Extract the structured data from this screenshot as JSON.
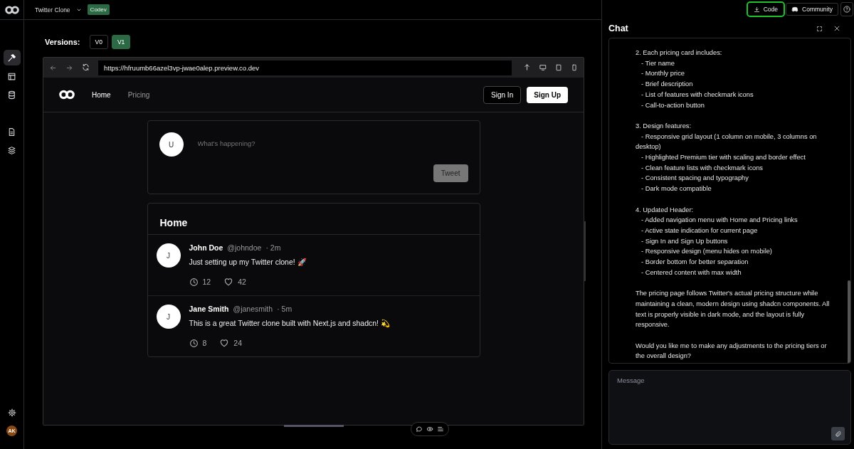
{
  "top_bar": {
    "project": "Twitter Clone",
    "badge": "Codev",
    "buttons": [
      {
        "label": "Code",
        "kind": "download",
        "highlighted": true
      },
      {
        "label": "Community",
        "kind": "discord",
        "highlighted": false
      }
    ]
  },
  "rail": {
    "items": [
      {
        "kind": "hammer",
        "selected": true
      },
      {
        "kind": "layout",
        "selected": false
      },
      {
        "kind": "database",
        "selected": false
      },
      {
        "kind": "file",
        "selected": false
      },
      {
        "kind": "layers",
        "selected": false
      }
    ],
    "avatar": "AK"
  },
  "versions": {
    "label": "Versions:",
    "tabs": [
      {
        "label": "V0",
        "selected": false
      },
      {
        "label": "V1",
        "selected": true
      }
    ]
  },
  "browser": {
    "url": "https://hfruumb66azel3vp-jwae0alep.preview.co.dev"
  },
  "preview": {
    "nav": [
      {
        "label": "Home",
        "selected": true
      },
      {
        "label": "Pricing",
        "selected": false
      }
    ],
    "sign_in": "Sign In",
    "sign_up": "Sign Up",
    "composer": {
      "avatar": "U",
      "placeholder": "What's happening?",
      "button": "Tweet"
    },
    "feed_title": "Home",
    "tweets": [
      {
        "avatar": "J",
        "name": "John Doe",
        "handle": "@johndoe",
        "time": "· 2m",
        "text": "Just setting up my Twitter clone! 🚀",
        "replies": "12",
        "likes": "42"
      },
      {
        "avatar": "J",
        "name": "Jane Smith",
        "handle": "@janesmith",
        "time": "· 5m",
        "text": "This is a great Twitter clone built with Next.js and shadcn! 💫",
        "replies": "8",
        "likes": "24"
      }
    ]
  },
  "chat": {
    "title": "Chat",
    "blocks": [
      {
        "kind": "list",
        "heading": "2. Each pricing card includes:",
        "items": [
          "- Tier name",
          "- Monthly price",
          "- Brief description",
          "- List of features with checkmark icons",
          "- Call-to-action button"
        ]
      },
      {
        "kind": "list",
        "heading": "3. Design features:",
        "items": [
          "- Responsive grid layout (1 column on mobile, 3 columns on desktop)",
          "- Highlighted Premium tier with scaling and border effect",
          "- Clean feature lists with checkmark icons",
          "- Consistent spacing and typography",
          "- Dark mode compatible"
        ]
      },
      {
        "kind": "list",
        "heading": "4. Updated Header:",
        "items": [
          "- Added navigation menu with Home and Pricing links",
          "- Active state indication for current page",
          "- Sign In and Sign Up buttons",
          "- Responsive design (menu hides on mobile)",
          "- Border bottom for better separation",
          "- Centered content with max width"
        ]
      },
      {
        "kind": "paragraph",
        "text": "The pricing page follows Twitter's actual pricing structure while maintaining a clean, modern design using shadcn components. All text is properly visible in dark mode, and the layout is fully responsive."
      },
      {
        "kind": "paragraph",
        "text": "Would you like me to make any adjustments to the pricing tiers or the overall design?"
      }
    ],
    "placeholder": "Message"
  }
}
